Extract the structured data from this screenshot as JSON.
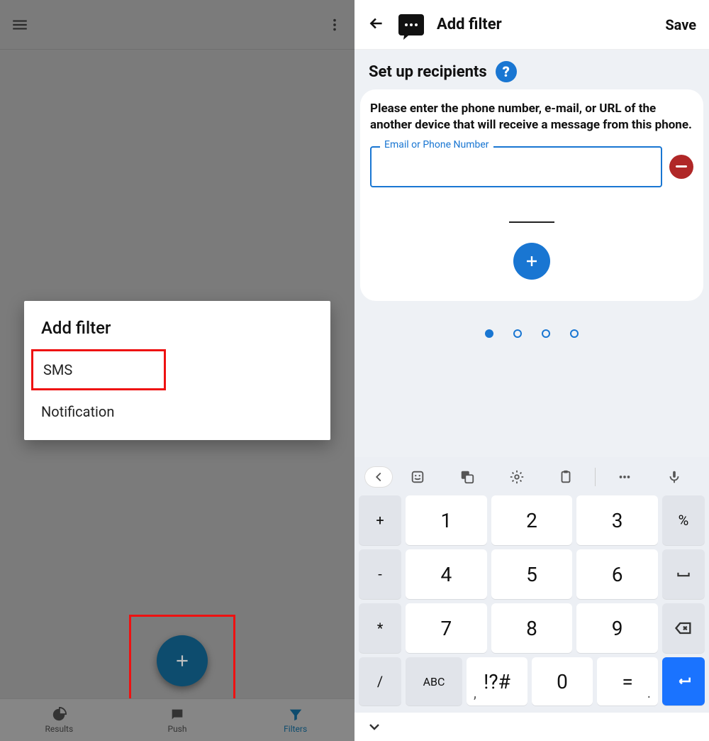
{
  "left": {
    "dialog_title": "Add filter",
    "option_sms": "SMS",
    "option_notification": "Notification",
    "nav_results": "Results",
    "nav_push": "Push",
    "nav_filters": "Filters"
  },
  "right": {
    "title": "Add filter",
    "save": "Save",
    "subtitle": "Set up recipients",
    "help": "?",
    "description": "Please enter the phone number, e-mail, or URL of the another device that will receive a message from this phone.",
    "field_label": "Email or Phone Number",
    "field_value": ""
  },
  "kb": {
    "side_left": [
      "+",
      "-",
      "*",
      "/"
    ],
    "digits": [
      [
        "1",
        "2",
        "3"
      ],
      [
        "4",
        "5",
        "6"
      ],
      [
        "7",
        "8",
        "9"
      ]
    ],
    "side_right": [
      "%",
      "␣",
      "⌫"
    ],
    "bottom": {
      "abc": "ABC",
      "comma": ",",
      "sym": "!?#",
      "zero": "0",
      "eq": "=",
      "dot": "."
    }
  }
}
